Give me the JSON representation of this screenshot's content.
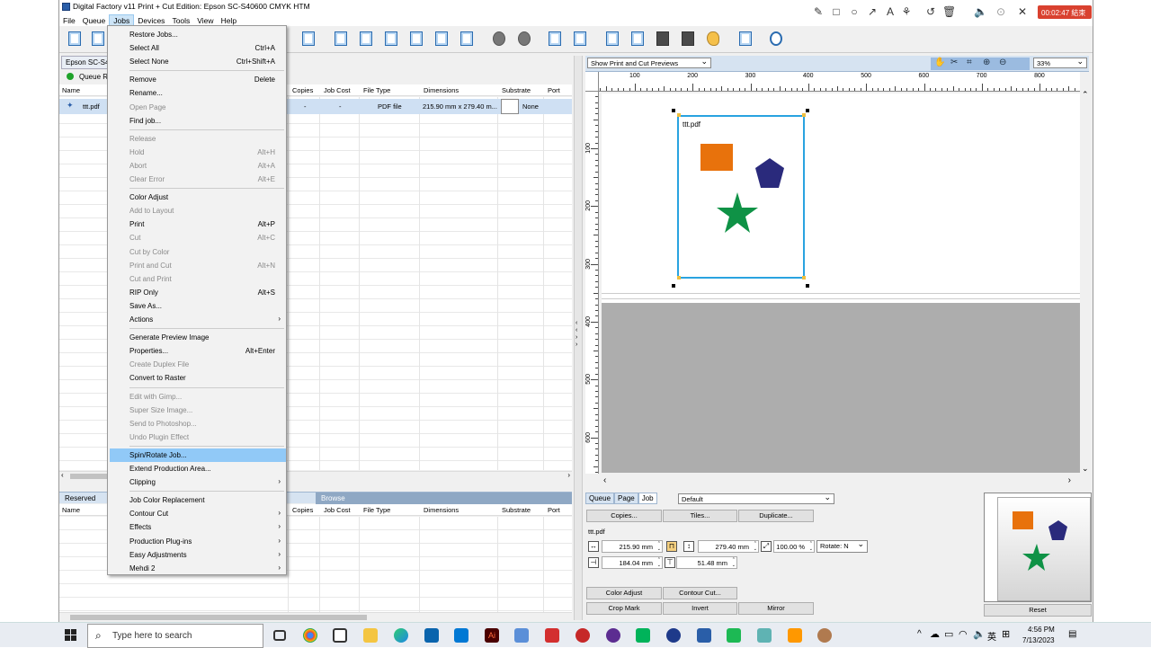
{
  "window": {
    "title": "Digital Factory v11 Print + Cut Edition: Epson SC-S40600 CMYK HTM"
  },
  "menubar": [
    "File",
    "Queue",
    "Jobs",
    "Devices",
    "Tools",
    "View",
    "Help"
  ],
  "queue_panel": {
    "tab": "Epson SC-S40",
    "status": "Queue R",
    "columns": [
      "Name",
      "Copies",
      "Job Cost",
      "File Type",
      "Dimensions",
      "Substrate",
      "Port"
    ],
    "row": {
      "name": "ttt.pdf",
      "copies": "-",
      "job_cost": "-",
      "file_type": "PDF file",
      "dimensions": "215.90 mm x 279.40 m...",
      "substrate": "None",
      "port": "-"
    }
  },
  "reserved_panel": {
    "tab": "Reserved",
    "browse_tab": "Browse",
    "columns": [
      "Name",
      "Copies",
      "Job Cost",
      "File Type",
      "Dimensions",
      "Substrate",
      "Port"
    ]
  },
  "preview": {
    "mode": "Show Print and Cut Previews",
    "zoom": "33%",
    "ruler_h": [
      "100",
      "200",
      "300",
      "400",
      "500",
      "600",
      "700",
      "800"
    ],
    "ruler_v": [
      "100",
      "200",
      "300",
      "400",
      "500",
      "600"
    ],
    "sheet_label": "ttt.pdf",
    "shape_colors": {
      "square": "#e8720c",
      "pentagon": "#2a2a7c",
      "star": "#0f9246"
    }
  },
  "job_panel": {
    "tabs": [
      "Queue",
      "Page",
      "Job"
    ],
    "preset": "Default",
    "buttons_top": [
      "Copies...",
      "Tiles...",
      "Duplicate..."
    ],
    "filename": "ttt.pdf",
    "width": "215.90 mm",
    "height": "279.40 mm",
    "scale": "100.00 %",
    "rotate_label": "Rotate:",
    "rotate_value": "N",
    "x": "184.04 mm",
    "y": "51.48 mm",
    "buttons_bottom_1": [
      "Color Adjust",
      "Contour Cut..."
    ],
    "buttons_bottom_2": [
      "Crop Mark",
      "Invert",
      "Mirror"
    ],
    "reset": "Reset"
  },
  "jobs_menu": {
    "items": [
      {
        "label": "Restore Jobs...",
        "shortcut": "",
        "disabled": false
      },
      {
        "label": "Select All",
        "shortcut": "Ctrl+A",
        "disabled": false
      },
      {
        "label": "Select None",
        "shortcut": "Ctrl+Shift+A",
        "disabled": false
      },
      {
        "sep": true
      },
      {
        "label": "Remove",
        "shortcut": "Delete",
        "disabled": false
      },
      {
        "label": "Rename...",
        "shortcut": "",
        "disabled": false
      },
      {
        "label": "Open Page",
        "shortcut": "",
        "disabled": true
      },
      {
        "label": "Find job...",
        "shortcut": "",
        "disabled": false
      },
      {
        "sep": true
      },
      {
        "label": "Release",
        "shortcut": "",
        "disabled": true
      },
      {
        "label": "Hold",
        "shortcut": "Alt+H",
        "disabled": true
      },
      {
        "label": "Abort",
        "shortcut": "Alt+A",
        "disabled": true
      },
      {
        "label": "Clear Error",
        "shortcut": "Alt+E",
        "disabled": true
      },
      {
        "sep": true
      },
      {
        "label": "Color Adjust",
        "shortcut": "",
        "disabled": false
      },
      {
        "label": "Add to Layout",
        "shortcut": "",
        "disabled": true
      },
      {
        "label": "Print",
        "shortcut": "Alt+P",
        "disabled": false
      },
      {
        "label": "Cut",
        "shortcut": "Alt+C",
        "disabled": true
      },
      {
        "label": "Cut by Color",
        "shortcut": "",
        "disabled": true
      },
      {
        "label": "Print and Cut",
        "shortcut": "Alt+N",
        "disabled": true
      },
      {
        "label": "Cut and Print",
        "shortcut": "",
        "disabled": true
      },
      {
        "label": "RIP Only",
        "shortcut": "Alt+S",
        "disabled": false
      },
      {
        "label": "Save As...",
        "shortcut": "",
        "disabled": false
      },
      {
        "label": "Actions",
        "shortcut": "",
        "disabled": false,
        "submenu": true
      },
      {
        "sep": true
      },
      {
        "label": "Generate Preview Image",
        "shortcut": "",
        "disabled": false
      },
      {
        "label": "Properties...",
        "shortcut": "Alt+Enter",
        "disabled": false
      },
      {
        "label": "Create Duplex File",
        "shortcut": "",
        "disabled": true
      },
      {
        "label": "Convert to Raster",
        "shortcut": "",
        "disabled": false
      },
      {
        "sep": true
      },
      {
        "label": "Edit with Gimp...",
        "shortcut": "",
        "disabled": true
      },
      {
        "label": "Super Size Image...",
        "shortcut": "",
        "disabled": true
      },
      {
        "label": "Send to Photoshop...",
        "shortcut": "",
        "disabled": true
      },
      {
        "label": "Undo Plugin Effect",
        "shortcut": "",
        "disabled": true
      },
      {
        "sep": true
      },
      {
        "label": "Spin/Rotate Job...",
        "shortcut": "",
        "disabled": false,
        "highlight": true
      },
      {
        "label": "Extend Production Area...",
        "shortcut": "",
        "disabled": false
      },
      {
        "label": "Clipping",
        "shortcut": "",
        "disabled": false,
        "submenu": true
      },
      {
        "sep": true
      },
      {
        "label": "Job Color Replacement",
        "shortcut": "",
        "disabled": false
      },
      {
        "label": "Contour Cut",
        "shortcut": "",
        "disabled": false,
        "submenu": true
      },
      {
        "label": "Effects",
        "shortcut": "",
        "disabled": false,
        "submenu": true
      },
      {
        "label": "Production Plug-ins",
        "shortcut": "",
        "disabled": false,
        "submenu": true
      },
      {
        "label": "Easy Adjustments",
        "shortcut": "",
        "disabled": false,
        "submenu": true
      },
      {
        "label": "Mehdi 2",
        "shortcut": "",
        "disabled": false,
        "submenu": true
      }
    ]
  },
  "recorder": {
    "timer": "00:02:47 結束"
  },
  "taskbar": {
    "search_placeholder": "Type here to search",
    "time": "4:56 PM",
    "date": "7/13/2023",
    "lang": "英"
  }
}
